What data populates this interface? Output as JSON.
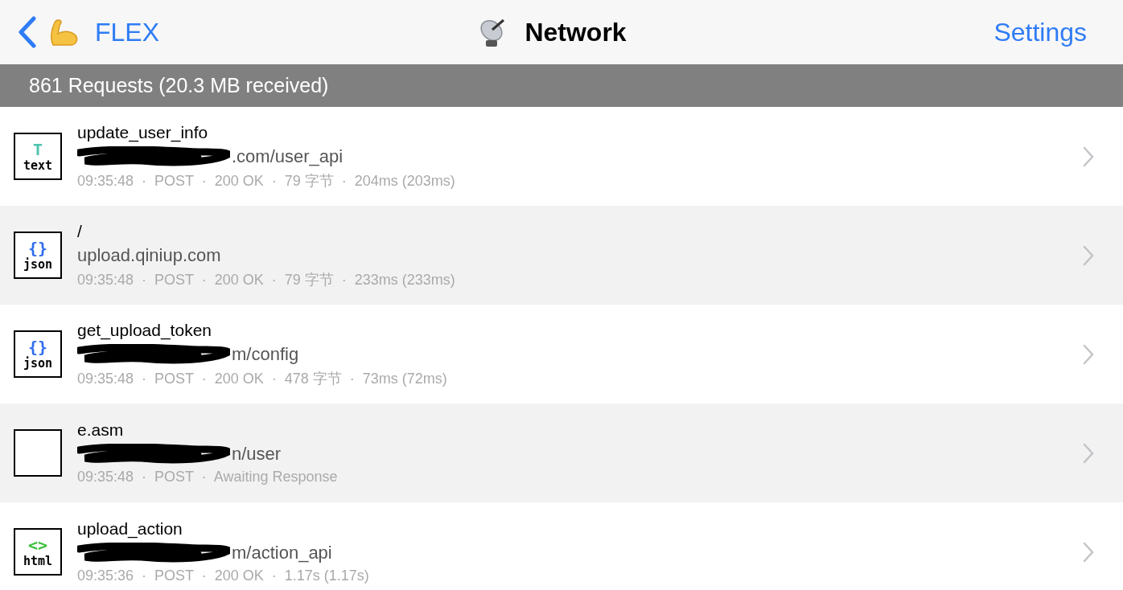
{
  "nav": {
    "back_label": "FLEX",
    "title": "Network",
    "settings": "Settings"
  },
  "summary": "861 Requests (20.3 MB received)",
  "requests": [
    {
      "kind": "text",
      "glyph": "T",
      "type_label": "text",
      "name": "update_user_info",
      "redacted": true,
      "url": ".com/user_api",
      "meta": "09:35:48  ·  POST  ·  200 OK  ·  79 字节  ·  204ms (203ms)"
    },
    {
      "kind": "json",
      "glyph": "{}",
      "type_label": "json",
      "name": "/",
      "redacted": false,
      "url": "upload.qiniup.com",
      "meta": "09:35:48  ·  POST  ·  200 OK  ·  79 字节  ·  233ms (233ms)"
    },
    {
      "kind": "json",
      "glyph": "{}",
      "type_label": "json",
      "name": "get_upload_token",
      "redacted": true,
      "url": "m/config",
      "meta": "09:35:48  ·  POST  ·  200 OK  ·  478 字节  ·  73ms (72ms)"
    },
    {
      "kind": "none",
      "name": "e.asm",
      "redacted": true,
      "url": "n/user",
      "meta": "09:35:48  ·  POST  ·  Awaiting Response"
    },
    {
      "kind": "html",
      "glyph": "<>",
      "type_label": "html",
      "name": "upload_action",
      "redacted": true,
      "url": "m/action_api",
      "meta": "09:35:36  ·  POST  ·  200 OK  ·  1.17s (1.17s)"
    }
  ]
}
